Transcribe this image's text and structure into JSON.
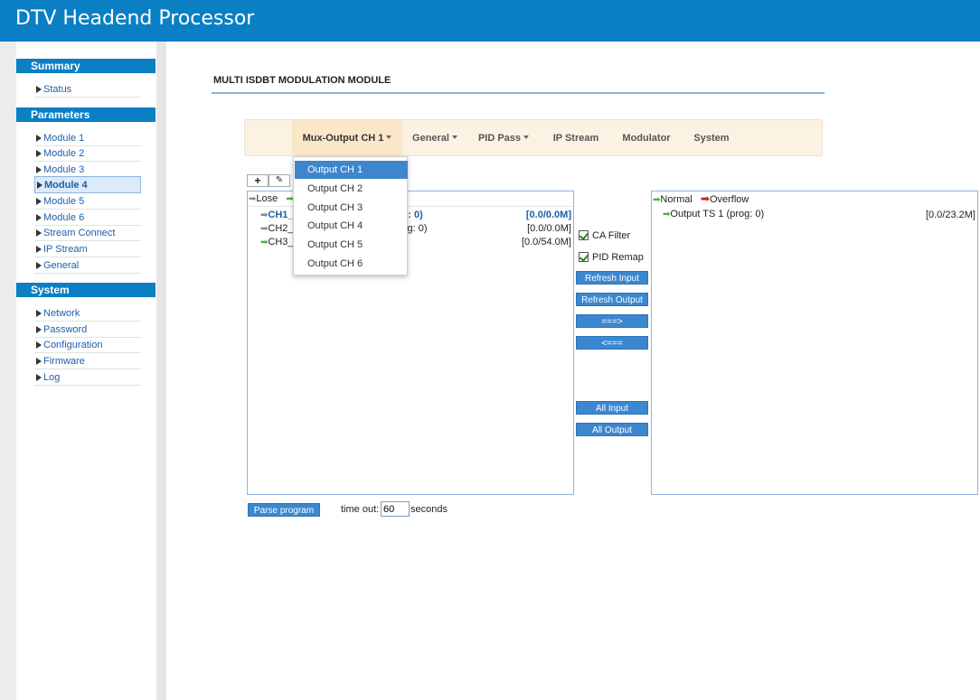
{
  "app": {
    "title": "DTV Headend Processor"
  },
  "sidebar": {
    "sections": [
      {
        "title": "Summary",
        "items": [
          "Status"
        ]
      },
      {
        "title": "Parameters",
        "items": [
          "Module 1",
          "Module 2",
          "Module 3",
          "Module 4",
          "Module 5",
          "Module 6",
          "Stream Connect",
          "IP Stream",
          "General"
        ]
      },
      {
        "title": "System",
        "items": [
          "Network",
          "Password",
          "Configuration",
          "Firmware",
          "Log"
        ]
      }
    ],
    "active_item": "Module 4"
  },
  "page": {
    "title": "MULTI ISDBT MODULATION MODULE"
  },
  "menu": {
    "items": [
      "Mux-Output CH 1",
      "General",
      "PID Pass",
      "IP Stream",
      "Modulator",
      "System"
    ],
    "active": "Mux-Output CH 1"
  },
  "dropdown": {
    "items": [
      "Output CH 1",
      "Output CH 2",
      "Output CH 3",
      "Output CH 4",
      "Output CH 5",
      "Output CH 6"
    ],
    "selected": "Output CH 1"
  },
  "toolbar": {
    "add_label": "+",
    "edit_label": "✎"
  },
  "input_panel": {
    "legend_lose": "Lose",
    "rows": [
      {
        "name": "CH1_",
        "suffix": "g: 0)",
        "rate": "[0.0/0.0M]"
      },
      {
        "name": "CH2_",
        "suffix": "g: 0)",
        "rate": "[0.0/0.0M]"
      },
      {
        "name": "CH3_",
        "suffix": "",
        "rate": "[0.0/54.0M]"
      }
    ]
  },
  "output_panel": {
    "legend_normal": "Normal",
    "legend_overflow": "Overflow",
    "rows": [
      {
        "name": "Output TS 1 (prog: 0)",
        "rate": "[0.0/23.2M]"
      }
    ]
  },
  "controls": {
    "ca_filter": "CA Filter",
    "pid_remap": "PID Remap",
    "refresh_input": "Refresh Input",
    "refresh_output": "Refresh Output",
    "forward": "===>",
    "backward": "<===",
    "all_input": "All Input",
    "all_output": "All Output"
  },
  "parse": {
    "button": "Parse program",
    "timeout_label": "time out:",
    "timeout_value": "60",
    "seconds_label": "seconds"
  },
  "colors": {
    "brand": "#0a7fc4",
    "menubar": "#fbf2e4",
    "selected": "#3d85cc"
  }
}
